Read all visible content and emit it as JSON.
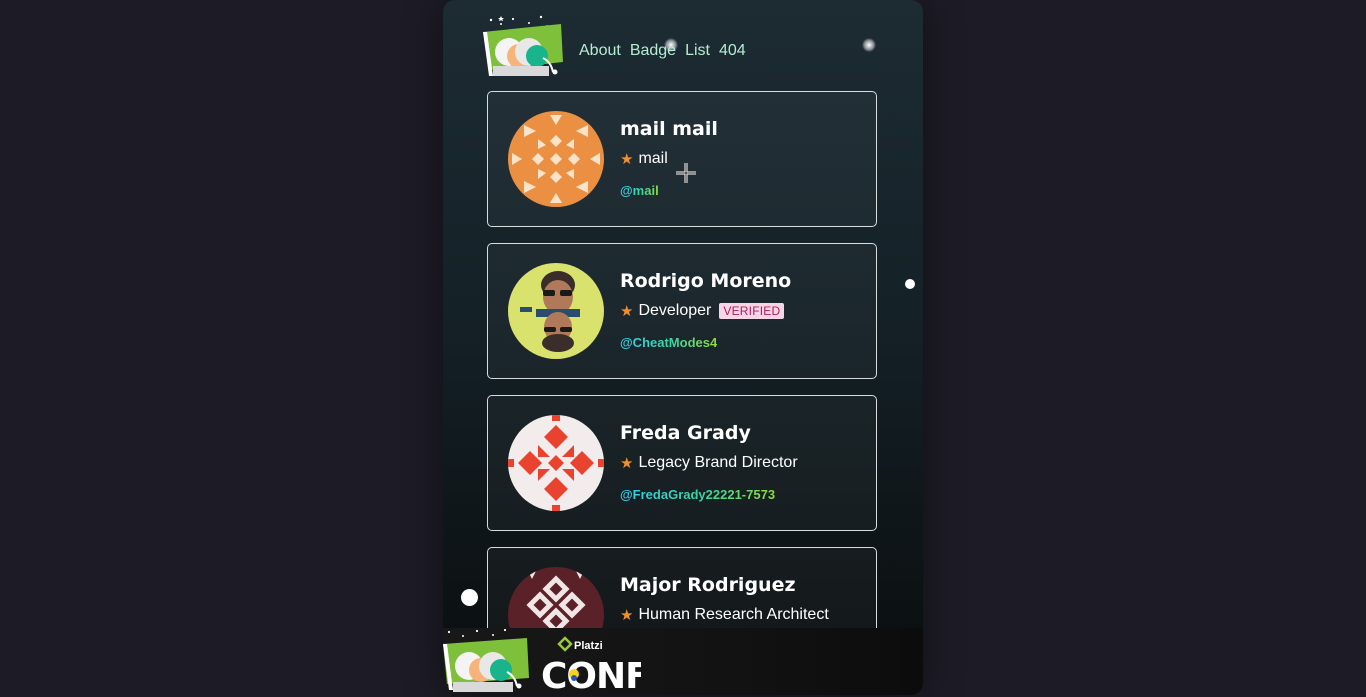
{
  "nav": {
    "links": [
      "About",
      "Badge",
      "List",
      "404"
    ]
  },
  "badges": [
    {
      "name": "mail mail",
      "job_title": "mail",
      "twitter": "@mail",
      "verified": false,
      "avatar_icon": "geometric-pattern-orange",
      "avatar_color": "#eb9042"
    },
    {
      "name": "Rodrigo Moreno",
      "job_title": "Developer",
      "twitter": "@CheatModes4",
      "verified": true,
      "verified_label": "VERIFIED",
      "avatar_icon": "user-photo",
      "avatar_color": "#d8e26c"
    },
    {
      "name": "Freda Grady",
      "job_title": "Legacy Brand Director",
      "twitter": "@FredaGrady22221-7573",
      "verified": false,
      "avatar_icon": "geometric-pattern-red",
      "avatar_color": "#e9432f"
    },
    {
      "name": "Major Rodriguez",
      "job_title": "Human Research Architect",
      "twitter": "",
      "verified": false,
      "avatar_icon": "geometric-pattern-maroon",
      "avatar_color": "#5a2228"
    }
  ],
  "footer": {
    "brand_small": "Platzi",
    "brand_large": "CONF"
  },
  "colors": {
    "accent_star": "#f0902d",
    "nav_link": "#b5ecd3",
    "verified_bg": "#f5d6e7",
    "verified_text": "#b51b5e"
  }
}
